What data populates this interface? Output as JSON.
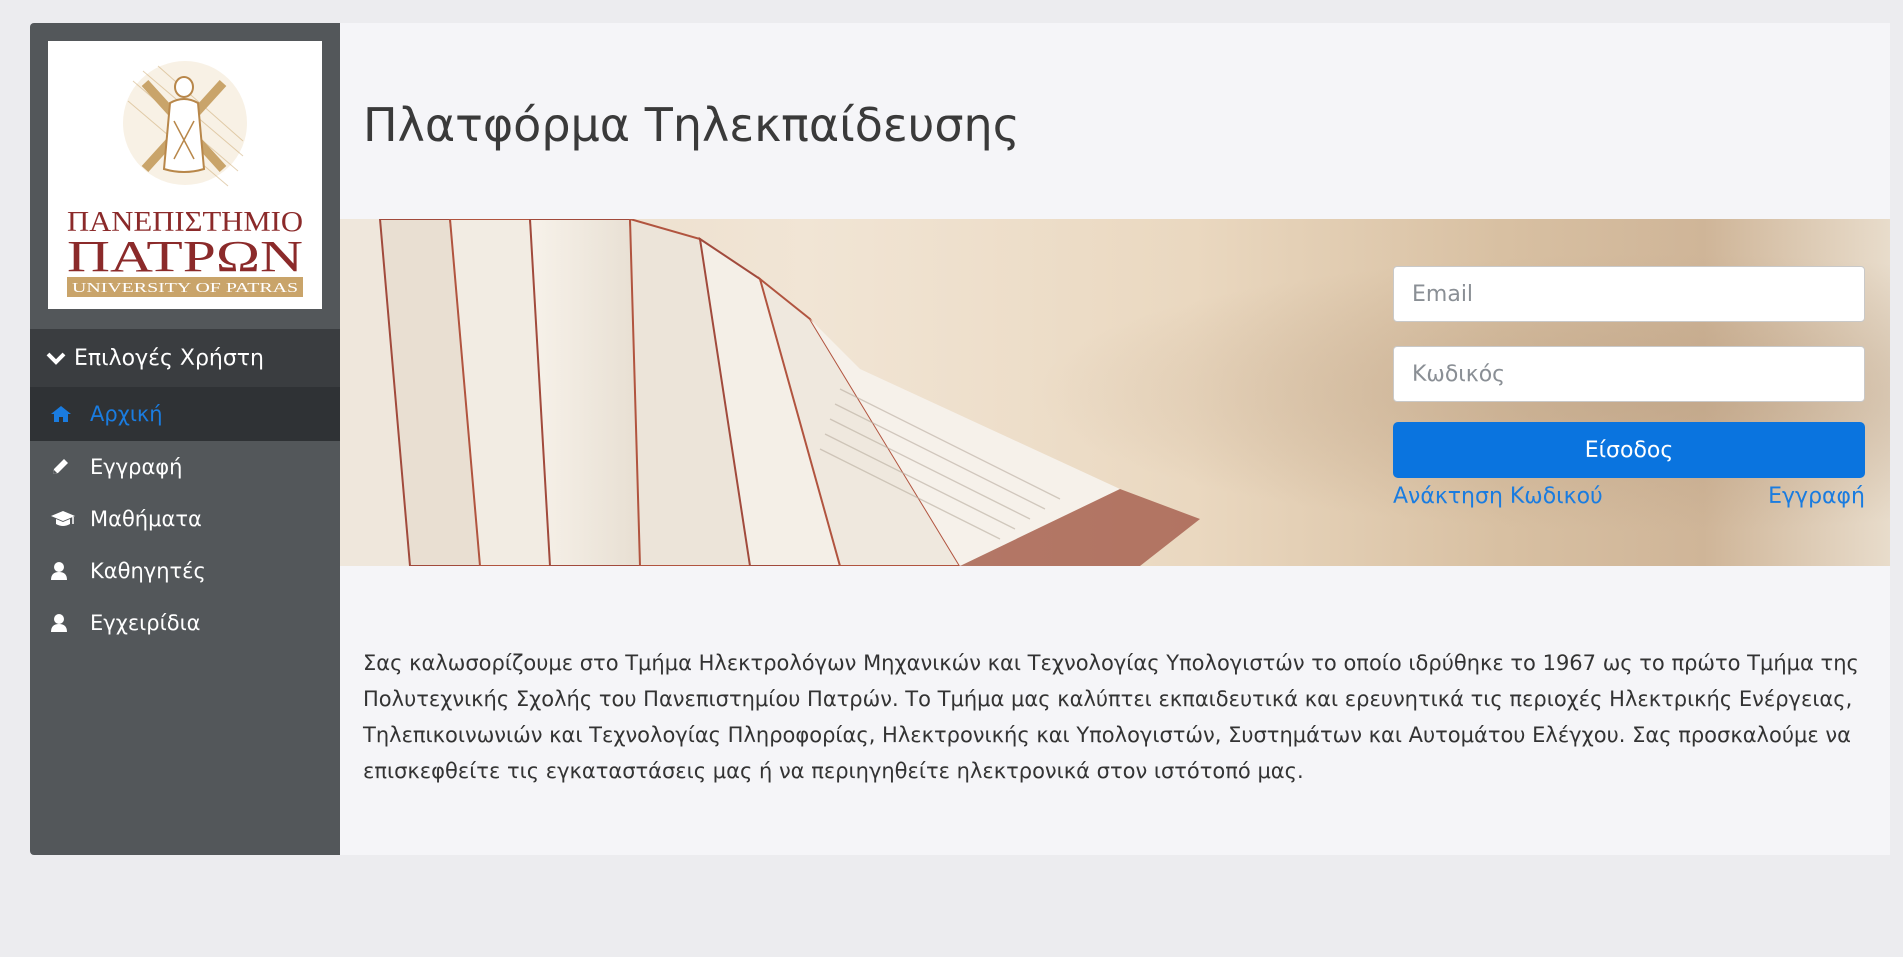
{
  "sidebar": {
    "logo": {
      "line1": "ΠΑΝΕΠΙΣΤΗΜΙΟ",
      "line2": "ΠΑΤΡΩΝ",
      "line3": "UNIVERSITY OF PATRAS"
    },
    "menu_header": "Επιλογές Χρήστη",
    "items": [
      {
        "label": "Αρχική",
        "icon": "home-icon",
        "active": true
      },
      {
        "label": "Εγγραφή",
        "icon": "pencil-icon",
        "active": false
      },
      {
        "label": "Μαθήματα",
        "icon": "graduation-cap-icon",
        "active": false
      },
      {
        "label": "Καθηγητές",
        "icon": "user-icon",
        "active": false
      },
      {
        "label": "Εγχειρίδια",
        "icon": "user-icon",
        "active": false
      }
    ]
  },
  "main": {
    "title": "Πλατφόρμα Τηλεκπαίδευσης",
    "login": {
      "email_placeholder": "Email",
      "password_placeholder": "Κωδικός",
      "submit_label": "Είσοδος",
      "recover_link": "Ανάκτηση Κωδικού",
      "register_link": "Εγγραφή"
    },
    "intro_text": "Σας καλωσορίζουμε στο Τμήμα Ηλεκτρολόγων Μηχανικών και Τεχνολογίας Υπολογιστών το οποίο ιδρύθηκε το 1967 ως το πρώτο Τμήμα της Πολυτεχνικής Σχολής του Πανεπιστημίου Πατρών. Το Τμήμα μας καλύπτει εκπαιδευτικά και ερευνητικά τις περιοχές Ηλεκτρικής Ενέργειας, Τηλεπικοινωνιών και Τεχνολογίας Πληροφορίας, Ηλεκτρονικής και Υπολογιστών, Συστημάτων και Αυτομάτου Ελέγχου. Σας προσκαλούμε να επισκεφθείτε τις εγκαταστάσεις μας ή να περιηγηθείτε ηλεκτρονικά στον ιστότοπό μας."
  },
  "colors": {
    "sidebar_bg": "#53575a",
    "sidebar_header_bg": "#3a3d40",
    "active_item_bg": "#2f3235",
    "accent": "#0a74df",
    "logo_red": "#8b2a2a",
    "logo_gold": "#c9a46a"
  }
}
